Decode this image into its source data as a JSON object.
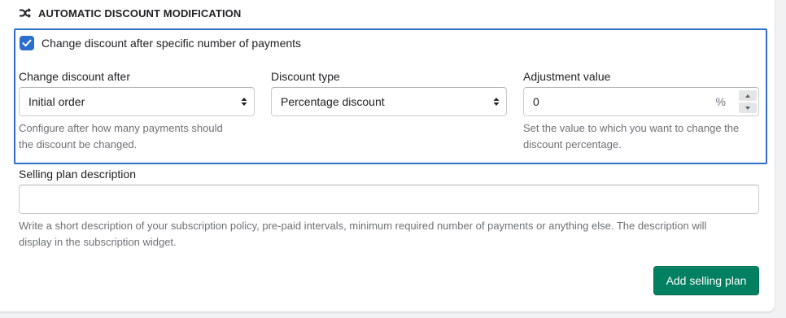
{
  "section": {
    "title": "AUTOMATIC DISCOUNT MODIFICATION",
    "icon": "shuffle-icon"
  },
  "checkbox": {
    "label": "Change discount after specific number of payments",
    "checked": true
  },
  "change_after": {
    "label": "Change discount after",
    "value": "Initial order",
    "help": [
      "Configure after how many payments should",
      "the discount be changed."
    ]
  },
  "discount_type": {
    "label": "Discount type",
    "value": "Percentage discount"
  },
  "adjustment": {
    "label": "Adjustment value",
    "value": "0",
    "suffix": "%",
    "help": [
      "Set the value to which you want to change the",
      "discount percentage."
    ]
  },
  "description": {
    "label": "Selling plan description",
    "value": "",
    "help": [
      "Write a short description of your subscription policy, pre-paid intervals, minimum required number of payments or anything else. The description will",
      "display in the subscription widget."
    ]
  },
  "actions": {
    "add_label": "Add selling plan"
  },
  "colors": {
    "accent": "#2c6ecb",
    "primary": "#008060"
  }
}
